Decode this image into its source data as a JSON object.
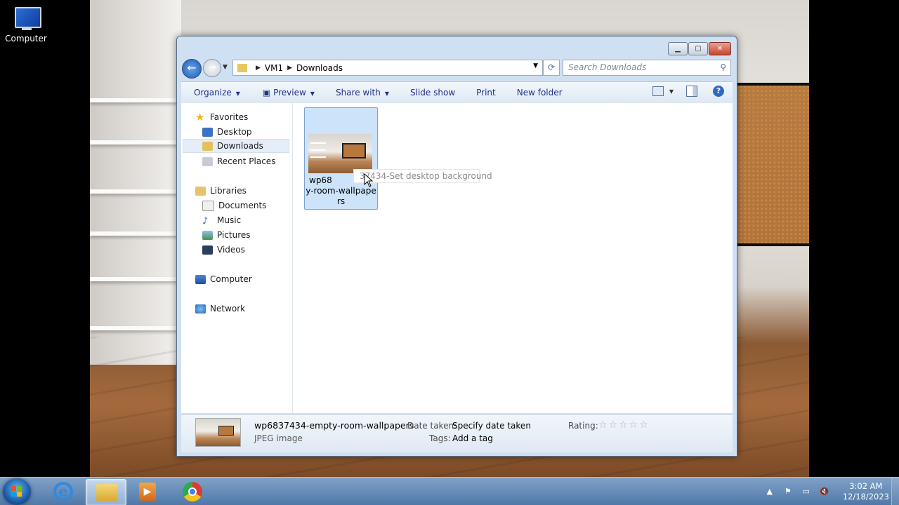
{
  "desktop": {
    "computer_icon_label": "Computer"
  },
  "window": {
    "address": {
      "crumbs": [
        "VM1",
        "Downloads"
      ]
    },
    "search": {
      "placeholder": "Search Downloads"
    },
    "toolbar": {
      "organize": "Organize",
      "preview": "Preview",
      "share_with": "Share with",
      "slide_show": "Slide show",
      "print": "Print",
      "new_folder": "New folder"
    },
    "nav": {
      "favorites": "Favorites",
      "desktop": "Desktop",
      "downloads": "Downloads",
      "recent_places": "Recent Places",
      "libraries": "Libraries",
      "documents": "Documents",
      "music": "Music",
      "pictures": "Pictures",
      "videos": "Videos",
      "computer": "Computer",
      "network": "Network"
    },
    "file": {
      "label_line1": "wp68",
      "label_line2": "y-room-wallpape",
      "label_line3": "rs",
      "tooltip": "37434-Set desktop background"
    },
    "details": {
      "name": "wp6837434-empty-room-wallpapers",
      "type": "JPEG image",
      "date_taken_label": "Date taken:",
      "date_taken_value": "Specify date taken",
      "tags_label": "Tags:",
      "tags_value": "Add a tag",
      "rating_label": "Rating:",
      "rating_stars": "☆☆☆☆☆"
    }
  },
  "taskbar": {
    "time": "3:02 AM",
    "date": "12/18/2023"
  }
}
